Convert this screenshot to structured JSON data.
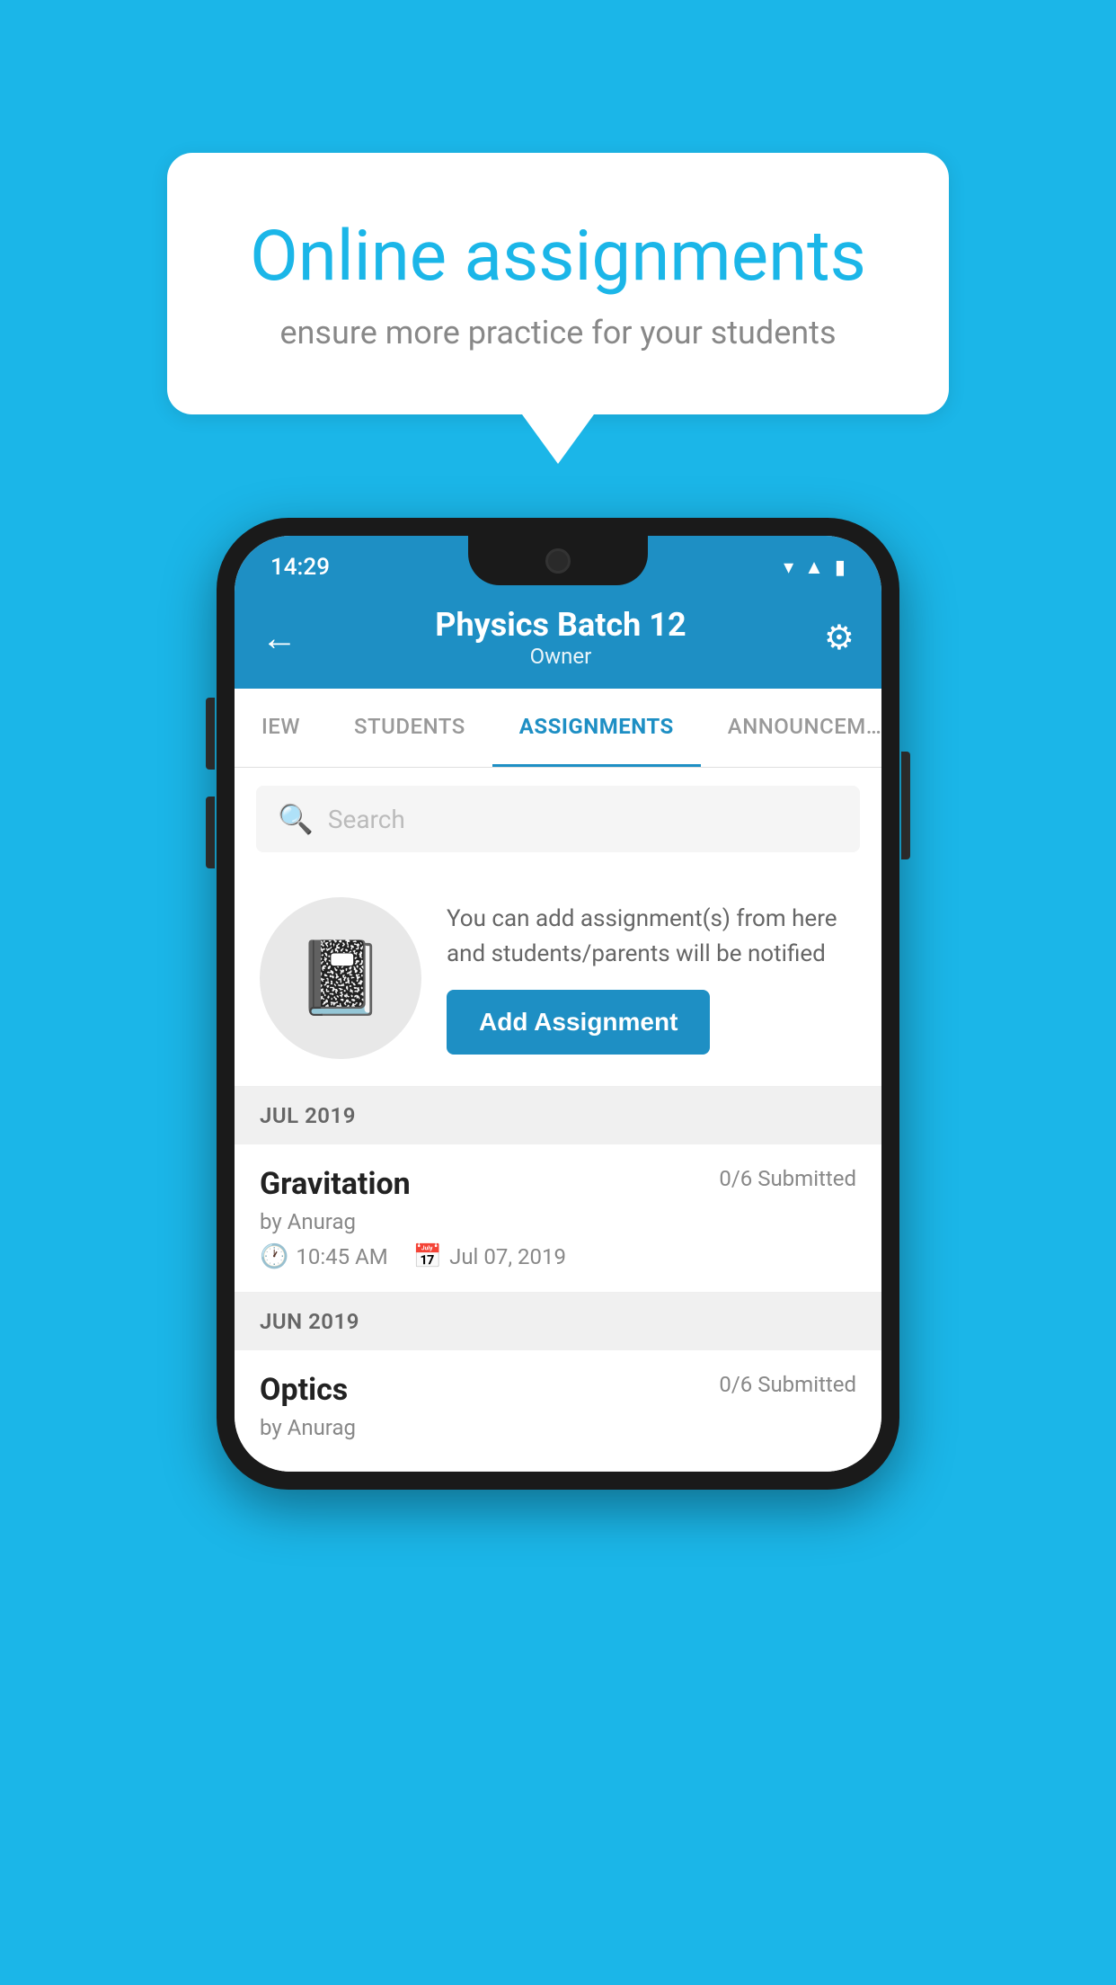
{
  "background_color": "#1bb6e8",
  "speech_bubble": {
    "title": "Online assignments",
    "subtitle": "ensure more practice for your students"
  },
  "status_bar": {
    "time": "14:29",
    "icons": [
      "wifi",
      "signal",
      "battery"
    ]
  },
  "header": {
    "title": "Physics Batch 12",
    "subtitle": "Owner",
    "back_label": "←",
    "settings_label": "⚙"
  },
  "tabs": [
    {
      "label": "IEW",
      "active": false
    },
    {
      "label": "STUDENTS",
      "active": false
    },
    {
      "label": "ASSIGNMENTS",
      "active": true
    },
    {
      "label": "ANNOUNCEM…",
      "active": false
    }
  ],
  "search": {
    "placeholder": "Search"
  },
  "add_promo": {
    "description": "You can add assignment(s) from here and students/parents will be notified",
    "button_label": "Add Assignment"
  },
  "sections": [
    {
      "label": "JUL 2019",
      "assignments": [
        {
          "title": "Gravitation",
          "submitted": "0/6 Submitted",
          "author": "by Anurag",
          "time": "10:45 AM",
          "date": "Jul 07, 2019"
        }
      ]
    },
    {
      "label": "JUN 2019",
      "assignments": [
        {
          "title": "Optics",
          "submitted": "0/6 Submitted",
          "author": "by Anurag",
          "time": "",
          "date": ""
        }
      ]
    }
  ]
}
